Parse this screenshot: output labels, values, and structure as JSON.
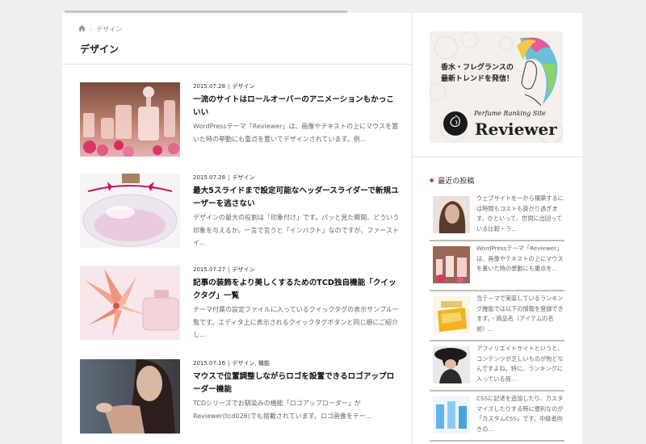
{
  "breadcrumb": {
    "current": "デザイン"
  },
  "page": {
    "title": "デザイン"
  },
  "posts": [
    {
      "date": "2015.07.28",
      "category": "デザイン",
      "title": "一流のサイトはロールオーバーのアニメーションもかっこいい",
      "excerpt": "WordPressテーマ「Reviewer」は、画像やテキストの上にマウスを置いた時の挙動にも重点を置いてデザインされています。例..."
    },
    {
      "date": "2015.07.28",
      "category": "デザイン",
      "title": "最大5スライドまで設定可能なヘッダースライダーで新規ユーザーを逃さない",
      "excerpt": "デザインの最大の役割は「印象付け」です。パッと見た瞬間、どういう印象を与えるか。一言で言うと「インパクト」なのですが、ファーストイ..."
    },
    {
      "date": "2015.07.27",
      "category": "デザイン",
      "title": "記事の装飾をより美しくするためのTCD独自機能「クイックタグ」一覧",
      "excerpt": "テーマ付属の設定ファイルに入っているクイックタグの表示サンプル一覧です。エディタ上に表示されるクイックタグボタンと同じ順にご紹介し..."
    },
    {
      "date": "2015.07.16",
      "category": "デザイン, 機能",
      "title": "マウスで位置調整しながらロゴを設置できるロゴアップローダー機能",
      "excerpt": "TCDシリーズでお馴染みの機能「ロゴアップローダー」がReviewer(tcd026)でも搭載されています。ロゴ画像をテー..."
    }
  ],
  "banner": {
    "tagline_1": "香水・フレグランスの",
    "tagline_2": "最新トレンドを発信！",
    "site_sub": "Perfume Ranking Site",
    "site_name": "Reviewer"
  },
  "sidebar": {
    "recent_heading": "最近の投稿",
    "recent": [
      {
        "text": "ウェブサイトを一から構築するには時間もコストも掛かり過ぎます。かといって、世間に出回っている比較・ラ..."
      },
      {
        "text": "WordPressテーマ「Reviewer」は、画像やテキストの上にマウスを置いた時の挙動にも重点を..."
      },
      {
        "text": "当テーマで実装しているランキング機能では以下の情報を登録できます。・商品名（アイテムの名前）..."
      },
      {
        "text": "アフィリエイトサイトというと、コンテンツが乏しいものが殆どなんですよね。特に、ランキングに入っている商..."
      },
      {
        "text": "CSSに記述を追加したり、カスタマイズしたりする時に便利なのが「カスタムCSS」です。中級者向きの..."
      }
    ]
  },
  "colors": {
    "accent": "#c0392b",
    "rule": "#e4e4e4"
  },
  "icons": {
    "home": "home-icon",
    "chevron": "chevron-right-icon"
  }
}
